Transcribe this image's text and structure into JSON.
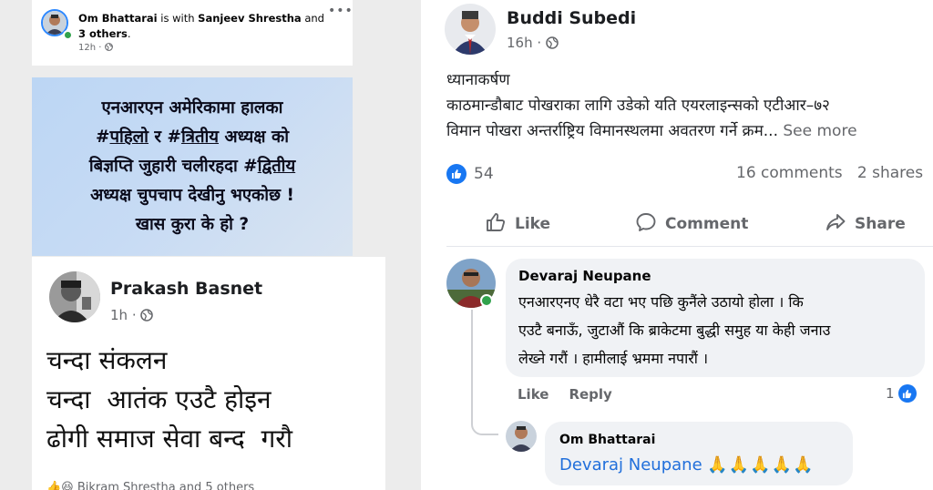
{
  "post1": {
    "author": "Om Bhattarai",
    "with_text": "is with",
    "tagged": "Sanjeev Shrestha",
    "and_text": "and",
    "others": "3 others",
    "time": "12h",
    "banner_line1": "एनआरएन अमेरिकामा हालका",
    "banner_line2_pre": "#",
    "banner_line2_tag1": "पहिलो",
    "banner_line2_mid": " र #",
    "banner_line2_tag2": "त्रितीय",
    "banner_line2_post": " अध्यक्ष को",
    "banner_line3_pre": "बिज्ञप्ति जुहारी चलीरहदा #",
    "banner_line3_tag": "द्वितीय",
    "banner_line4": "अध्यक्ष चुपचाप देखीनु भएकोछ !",
    "banner_line5": "खास कुरा के हो ?"
  },
  "post2": {
    "author": "Prakash Basnet",
    "time": "1h",
    "line1": "चन्दा संकलन",
    "line2": "चन्दा  आतंक एउटै होइन",
    "line3": "ढोगी समाज सेवा बन्द  गरौ",
    "footer": "Bikram Shrestha and 5 others"
  },
  "post3": {
    "author": "Buddi Subedi",
    "time": "16h",
    "line1": "ध्यानाकर्षण",
    "line2": "काठमान्डौबाट पोखराका लागि उडेको यति एयरलाइन्सको एटीआर–७२",
    "line3": "विमान पोखरा अन्तर्राष्ट्रिय विमानस्थलमा अवतरण गर्ने क्रम...",
    "see_more": "See more",
    "reaction_count": "54",
    "comments_count": "16 comments",
    "shares_count": "2 shares",
    "like_label": "Like",
    "comment_label": "Comment",
    "share_label": "Share"
  },
  "comment1": {
    "author": "Devaraj Neupane",
    "line1": "एनआरएनए धेरै वटा भए पछि कुनैंले उठायो होला । कि",
    "line2": "एउटै बनाऊँ, जुटाऔं कि ब्राकेटमा बुद्धी समुह या केही जनाउ",
    "line3": "लेख्ने गरौं । हामीलाई भ्रममा नपारौं ।",
    "like_action": "Like",
    "reply_action": "Reply",
    "like_count": "1"
  },
  "comment2": {
    "author": "Om Bhattarai",
    "mention": "Devaraj Neupane",
    "emojis": "🙏🙏🙏🙏🙏"
  },
  "colors": {
    "facebook_blue": "#1877f2",
    "online_green": "#31a24c",
    "mention_blue": "#216fdb",
    "banner_blue": "#c7dbf4"
  },
  "icons": {
    "globe": "globe-icon",
    "like": "thumbs-up-icon",
    "comment": "comment-bubble-icon",
    "share": "share-arrow-icon",
    "more": "more-dots-icon"
  }
}
